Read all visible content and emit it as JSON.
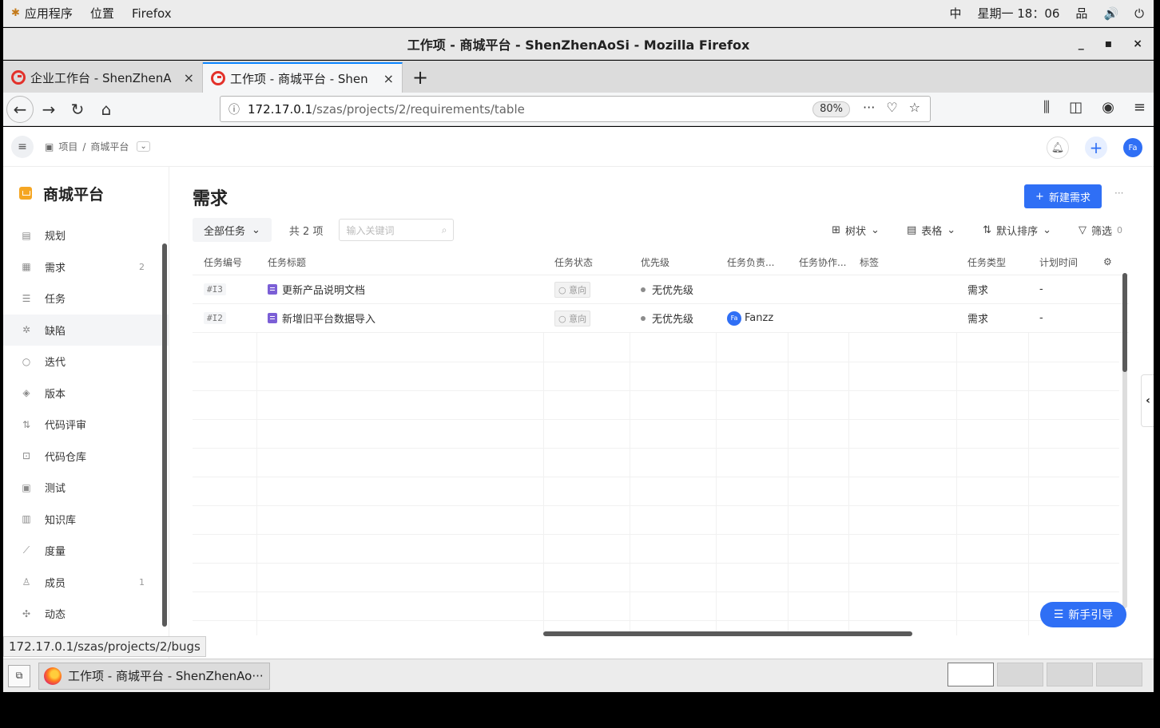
{
  "system_bar": {
    "apps_label": "应用程序",
    "places_label": "位置",
    "active_app": "Firefox",
    "input_method": "中",
    "clock": "星期一 18：06"
  },
  "window": {
    "title": "工作项 - 商城平台 - ShenZhenAoSi - Mozilla Firefox",
    "minimize": "_",
    "maximize": "▪",
    "close": "×"
  },
  "tabs": [
    {
      "label": "企业工作台 - ShenZhenA",
      "close": "×"
    },
    {
      "label": "工作项 - 商城平台 - Shen",
      "close": "×"
    }
  ],
  "new_tab": "+",
  "address": {
    "host": "172.17.0.1",
    "path": "/szas/projects/2/requirements/table",
    "zoom": "80%"
  },
  "header": {
    "breadcrumb_project": "项目",
    "breadcrumb_sep": "/",
    "breadcrumb_current": "商城平台",
    "avatar": "Fa"
  },
  "sidebar": {
    "project_name": "商城平台",
    "items": [
      {
        "label": "规划",
        "count": ""
      },
      {
        "label": "需求",
        "count": "2"
      },
      {
        "label": "任务",
        "count": ""
      },
      {
        "label": "缺陷",
        "count": ""
      },
      {
        "label": "迭代",
        "count": ""
      },
      {
        "label": "版本",
        "count": ""
      },
      {
        "label": "代码评审",
        "count": ""
      },
      {
        "label": "代码仓库",
        "count": ""
      },
      {
        "label": "测试",
        "count": ""
      },
      {
        "label": "知识库",
        "count": ""
      },
      {
        "label": "度量",
        "count": ""
      },
      {
        "label": "成员",
        "count": "1"
      },
      {
        "label": "动态",
        "count": ""
      }
    ]
  },
  "main": {
    "title": "需求",
    "new_button": "新建需求",
    "more": "···",
    "filter": "全部任务",
    "total": "共 2 项",
    "search_placeholder": "输入关键词",
    "view_tree": "树状",
    "view_table": "表格",
    "sort": "默认排序",
    "filter_label": "筛选",
    "filter_count": "0",
    "guide_button": "新手引导"
  },
  "table": {
    "columns": [
      "任务编号",
      "任务标题",
      "任务状态",
      "优先级",
      "任务负责...",
      "任务协作...",
      "标签",
      "任务类型",
      "计划时间"
    ],
    "rows": [
      {
        "id": "#I3",
        "title": "更新产品说明文档",
        "status": "意向",
        "priority": "无优先级",
        "assignee": "",
        "assignee_avatar": "",
        "collab": "",
        "tags": "",
        "type": "需求",
        "plan": "-"
      },
      {
        "id": "#I2",
        "title": "新增旧平台数据导入",
        "status": "意向",
        "priority": "无优先级",
        "assignee": "Fanzz",
        "assignee_avatar": "Fa",
        "collab": "",
        "tags": "",
        "type": "需求",
        "plan": "-"
      }
    ]
  },
  "status_url": "172.17.0.1/szas/projects/2/bugs",
  "taskbar": {
    "window_label": "工作项 - 商城平台 - ShenZhenAo···"
  }
}
